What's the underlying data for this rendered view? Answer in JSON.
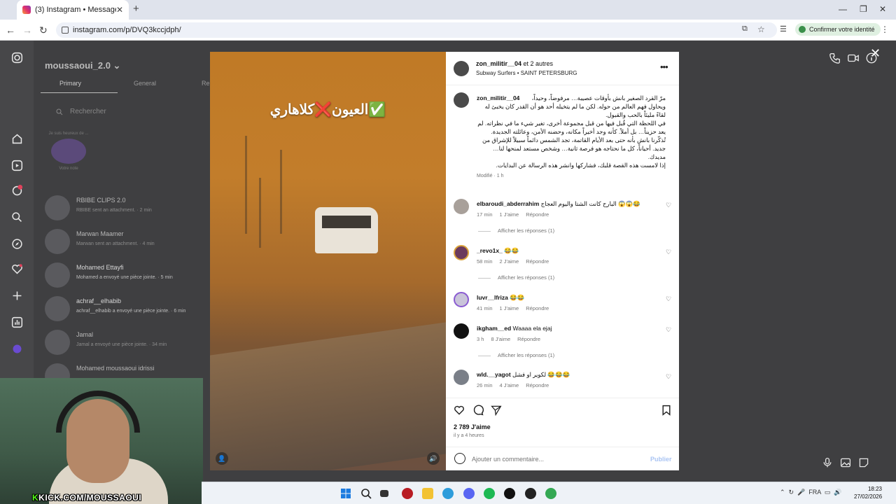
{
  "browser": {
    "tab_title": "(3) Instagram • Messages",
    "url": "instagram.com/p/DVQ3kccjdph/",
    "identity_button": "Confirmer votre identité"
  },
  "dm_list": {
    "username": "moussaoui_2.0",
    "tabs": [
      "Primary",
      "General",
      "Re"
    ],
    "search_placeholder": "Rechercher",
    "note_text": "Je suis heureux de ...",
    "note_label": "Votre note",
    "threads": [
      {
        "name": "RBIBE CLIPS 2.0",
        "preview": "RBIBE sent an attachment. · 2 min"
      },
      {
        "name": "Marwan Maamer",
        "preview": "Marwan sent an attachment. · 4 min"
      },
      {
        "name": "Mohamed Ettayfi",
        "preview": "Mohamed a envoyé une pièce jointe. · 5 min"
      },
      {
        "name": "achraf__elhabib",
        "preview": "achraf__elhabib a envoyé une pièce jointe. · 6 min"
      },
      {
        "name": "Jamal",
        "preview": "Jamal a envoyé une pièce jointe. · 34 min"
      },
      {
        "name": "Mohamed moussaoui idrissi",
        "preview": ""
      }
    ]
  },
  "video": {
    "caption_text": "العيون❌كلاهاري✅"
  },
  "post": {
    "header_user": "zon_militir__04",
    "header_suffix": " et 2 autres",
    "header_sub": "Subway Surfers • SAINT PETERSBURG",
    "caption_user": "zon_militir__04",
    "caption_text": "مرّ القرد الصغير بانش بأوقات عصيبة… مرفوضاً، وحيداً، ويحاول فهم العالم من حوله. لكن ما لم يتخيله أحد هو أن القدر كان يخبئ له لقاءً مليئاً بالحب والقبول.\nفي اللحظة التي قُبل فيها من قبل مجموعة أخرى، تغير شيء ما في نظراته. لم يعد حزيناً… بل أملاً. كأنه وجد أخيراً مكانه، وحضنه الأمن، وعائلته الجديدة.\nتُذكّرنا بانش بأنه حتى بعد الأيام القاتمة، تجد الشمس دائماً سبيلاً للإشراق من جديد. أحياناً، كل ما نحتاجه هو فرصة ثانية… وشخص مستعد لمنحها لنا… مديدك.\nإذا لامست هذه القصة قلبك، فشاركها وانشر هذه الرسالة عن البدايات.",
    "caption_meta": "Modifié · 1 h",
    "comments": [
      {
        "user": "elbaroudi_abderrahim",
        "text": "البارح كانت الشتا واليوم العجاج 😱😱😂",
        "time": "17 min",
        "likes": "1 J'aime",
        "reply": "Répondre",
        "replies": "Afficher les réponses (1)"
      },
      {
        "user": "_revo1x_",
        "text": "😂😂",
        "time": "58 min",
        "likes": "2 J'aime",
        "reply": "Répondre",
        "replies": "Afficher les réponses (1)"
      },
      {
        "user": "luvr__lfriza",
        "text": "😂😂",
        "time": "41 min",
        "likes": "1 J'aime",
        "reply": "Répondre",
        "replies": ""
      },
      {
        "user": "ikgham__ed",
        "text": "Waaaa ela ejaj",
        "time": "3 h",
        "likes": "8 J'aime",
        "reply": "Répondre",
        "replies": "Afficher les réponses (1)"
      },
      {
        "user": "wld.__yagot",
        "text": "لكوير او فشل 😂😂😂",
        "time": "26 min",
        "likes": "4 J'aime",
        "reply": "Répondre",
        "replies": ""
      }
    ],
    "likes_count": "2 789 J'aime",
    "posted_ago": "il y a 4 heures",
    "comment_placeholder": "Ajouter un commentaire...",
    "publish_label": "Publier"
  },
  "webcam_overlay": {
    "prefix": "K",
    "text": "KICK.COM/MOUSSAOUI"
  },
  "taskbar": {
    "lang": "FRA",
    "time": "18:23",
    "date": "27/02/2026"
  },
  "colors": {
    "overlay_bg": "#3f3f41",
    "link_blue": "#a9c4f3",
    "kick_green": "#53fc18"
  }
}
